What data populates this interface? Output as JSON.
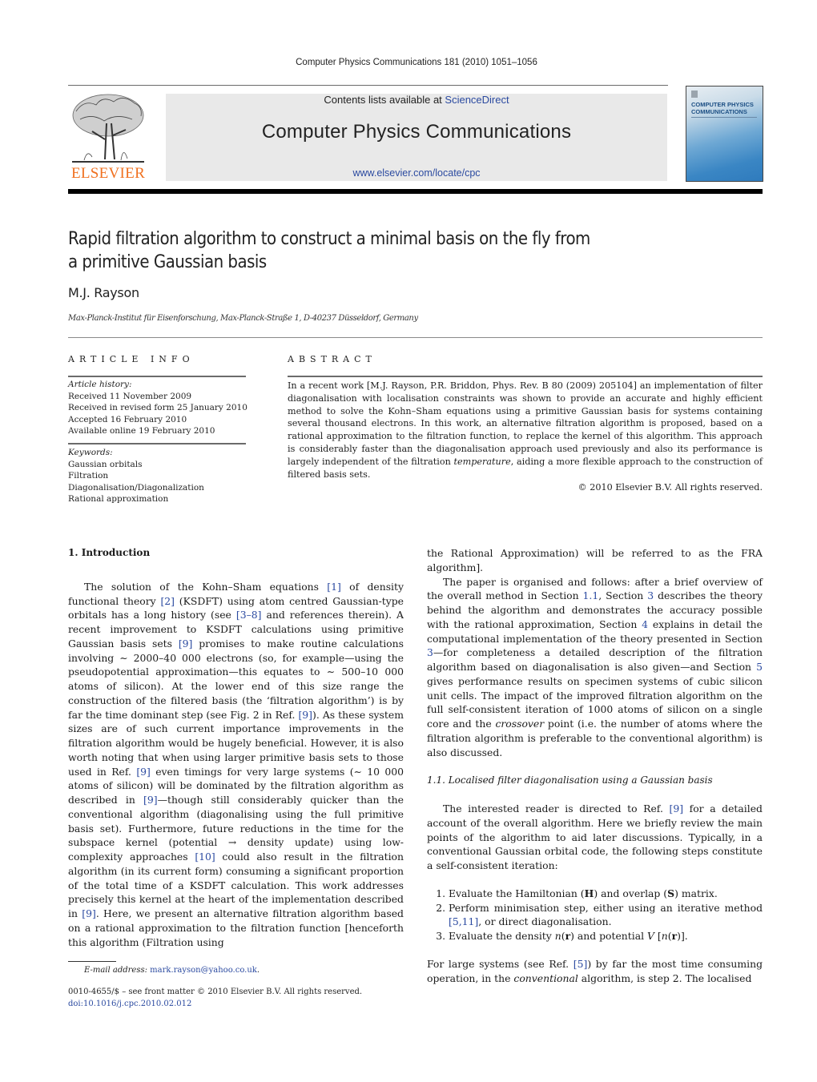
{
  "journal_ref": "Computer Physics Communications 181 (2010) 1051–1056",
  "masthead": {
    "publisher": "ELSEVIER",
    "contents_prefix": "Contents lists available at ",
    "contents_link": "ScienceDirect",
    "journal_title": "Computer Physics Communications",
    "journal_url": "www.elsevier.com/locate/cpc",
    "cover_title": "COMPUTER PHYSICS COMMUNICATIONS",
    "publisher_color": "#f0701f",
    "link_color": "#2b4aa0"
  },
  "article": {
    "title_line1": "Rapid filtration algorithm to construct a minimal basis on the fly from",
    "title_line2": "a primitive Gaussian basis",
    "author": "M.J. Rayson",
    "affiliation": "Max-Planck-Institut für Eisenforschung, Max-Planck-Straße 1, D-40237 Düsseldorf, Germany"
  },
  "article_info": {
    "heading": "ARTICLE INFO",
    "history_label": "Article history:",
    "history": [
      "Received 11 November 2009",
      "Received in revised form 25 January 2010",
      "Accepted 16 February 2010",
      "Available online 19 February 2010"
    ],
    "keywords_label": "Keywords:",
    "keywords": [
      "Gaussian orbitals",
      "Filtration",
      "Diagonalisation/Diagonalization",
      "Rational approximation"
    ]
  },
  "abstract": {
    "heading": "ABSTRACT",
    "text_a": "In a recent work [M.J. Rayson, P.R. Briddon, Phys. Rev. B 80 (2009) 205104] an implementation of filter diagonalisation with localisation constraints was shown to provide an accurate and highly efficient method to solve the Kohn–Sham equations using a primitive Gaussian basis for systems containing several thousand electrons. In this work, an alternative filtration algorithm is proposed, based on a rational approximation to the filtration function, to replace the kernel of this algorithm. This approach is considerably faster than the diagonalisation approach used previously and also its performance is largely independent of the filtration ",
    "text_em": "temperature",
    "text_b": ", aiding a more flexible approach to the construction of filtered basis sets.",
    "copyright": "© 2010 Elsevier B.V. All rights reserved."
  },
  "body": {
    "intro_heading": "1. Introduction",
    "intro_p1": [
      {
        "t": "The solution of the Kohn–Sham equations "
      },
      {
        "t": "[1]",
        "link": true
      },
      {
        "t": " of density functional theory "
      },
      {
        "t": "[2]",
        "link": true
      },
      {
        "t": " (KSDFT) using atom centred Gaussian-type orbitals has a long history (see "
      },
      {
        "t": "[3–8]",
        "link": true
      },
      {
        "t": " and references therein). A recent improvement to KSDFT calculations using primitive Gaussian basis sets "
      },
      {
        "t": "[9]",
        "link": true
      },
      {
        "t": " promises to make routine calculations involving ∼ 2000–40 000 electrons (so, for example—using the pseudopotential approximation—this equates to ∼ 500–10 000 atoms of silicon). At the lower end of this size range the construction of the filtered basis (the ‘filtration algorithm’) is by far the time dominant step (see Fig. 2 in Ref. "
      },
      {
        "t": "[9]",
        "link": true
      },
      {
        "t": "). As these system sizes are of such current importance improvements in the filtration algorithm would be hugely beneficial. However, it is also worth noting that when using larger primitive basis sets to those used in Ref. "
      },
      {
        "t": "[9]",
        "link": true
      },
      {
        "t": " even timings for very large systems (∼ 10 000 atoms of silicon) will be dominated by the filtration algorithm as described in "
      },
      {
        "t": "[9]",
        "link": true
      },
      {
        "t": "—though still considerably quicker than the conventional algorithm (diagonalising using the full primitive basis set). Furthermore, future reductions in the time for the subspace kernel (potential → density update) using low-complexity approaches "
      },
      {
        "t": "[10]",
        "link": true
      },
      {
        "t": " could also result in the filtration algorithm (in its current form) consuming a significant proportion of the total time of a KSDFT calculation. This work addresses precisely this kernel at the heart of the implementation described in "
      },
      {
        "t": "[9]",
        "link": true
      },
      {
        "t": ". Here, we present an alternative filtration algorithm based on a rational approximation to the filtration function [henceforth this algorithm (Filtration using the Rational Approximation) will be referred to as the FRA algorithm]."
      }
    ],
    "intro_p2": [
      {
        "t": "The paper is organised and follows: after a brief overview of the overall method in Section "
      },
      {
        "t": "1.1",
        "link": true
      },
      {
        "t": ", Section "
      },
      {
        "t": "3",
        "link": true
      },
      {
        "t": " describes the theory behind the algorithm and demonstrates the accuracy possible with the rational approximation, Section "
      },
      {
        "t": "4",
        "link": true
      },
      {
        "t": " explains in detail the computational implementation of the theory presented in Section "
      },
      {
        "t": "3",
        "link": true
      },
      {
        "t": "—for completeness a detailed description of the filtration algorithm based on diagonalisation is also given—and Section "
      },
      {
        "t": "5",
        "link": true
      },
      {
        "t": " gives performance results on specimen systems of cubic silicon unit cells. The impact of the improved filtration algorithm on the full self-consistent iteration of 1000 atoms of silicon on a single core and the "
      },
      {
        "t": "crossover",
        "em": true
      },
      {
        "t": " point (i.e. the number of atoms where the filtration algorithm is preferable to the conventional algorithm) is also discussed."
      }
    ],
    "subsection_heading": "1.1. Localised filter diagonalisation using a Gaussian basis",
    "sub_p1": [
      {
        "t": "The interested reader is directed to Ref. "
      },
      {
        "t": "[9]",
        "link": true
      },
      {
        "t": " for a detailed account of the overall algorithm. Here we briefly review the main points of the algorithm to aid later discussions. Typically, in a conventional Gaussian orbital code, the following steps constitute a self-consistent iteration:"
      }
    ],
    "steps": [
      [
        {
          "t": "Evaluate the Hamiltonian ("
        },
        {
          "t": "H",
          "bold": true
        },
        {
          "t": ") and overlap ("
        },
        {
          "t": "S",
          "bold": true
        },
        {
          "t": ") matrix."
        }
      ],
      [
        {
          "t": "Perform minimisation step, either using an iterative method "
        },
        {
          "t": "[5,11]",
          "link": true
        },
        {
          "t": ", or direct diagonalisation."
        }
      ],
      [
        {
          "t": "Evaluate the density "
        },
        {
          "t": "n",
          "em": true
        },
        {
          "t": "("
        },
        {
          "t": "r",
          "bold": true
        },
        {
          "t": ") and potential "
        },
        {
          "t": "V",
          "em": true
        },
        {
          "t": " ["
        },
        {
          "t": "n",
          "em": true
        },
        {
          "t": "("
        },
        {
          "t": "r",
          "bold": true
        },
        {
          "t": ")]."
        }
      ]
    ],
    "sub_p2": [
      {
        "t": "For large systems (see Ref. "
      },
      {
        "t": "[5]",
        "link": true
      },
      {
        "t": ") by far the most time consuming operation, in the "
      },
      {
        "t": "conventional",
        "em": true
      },
      {
        "t": " algorithm, is step 2. The localised"
      }
    ]
  },
  "footer": {
    "email_label": "E-mail address:",
    "email": "mark.rayson@yahoo.co.uk",
    "email_suffix": ".",
    "front_matter": "0010-4655/$ – see front matter  © 2010 Elsevier B.V. All rights reserved.",
    "doi": "doi:10.1016/j.cpc.2010.02.012"
  }
}
